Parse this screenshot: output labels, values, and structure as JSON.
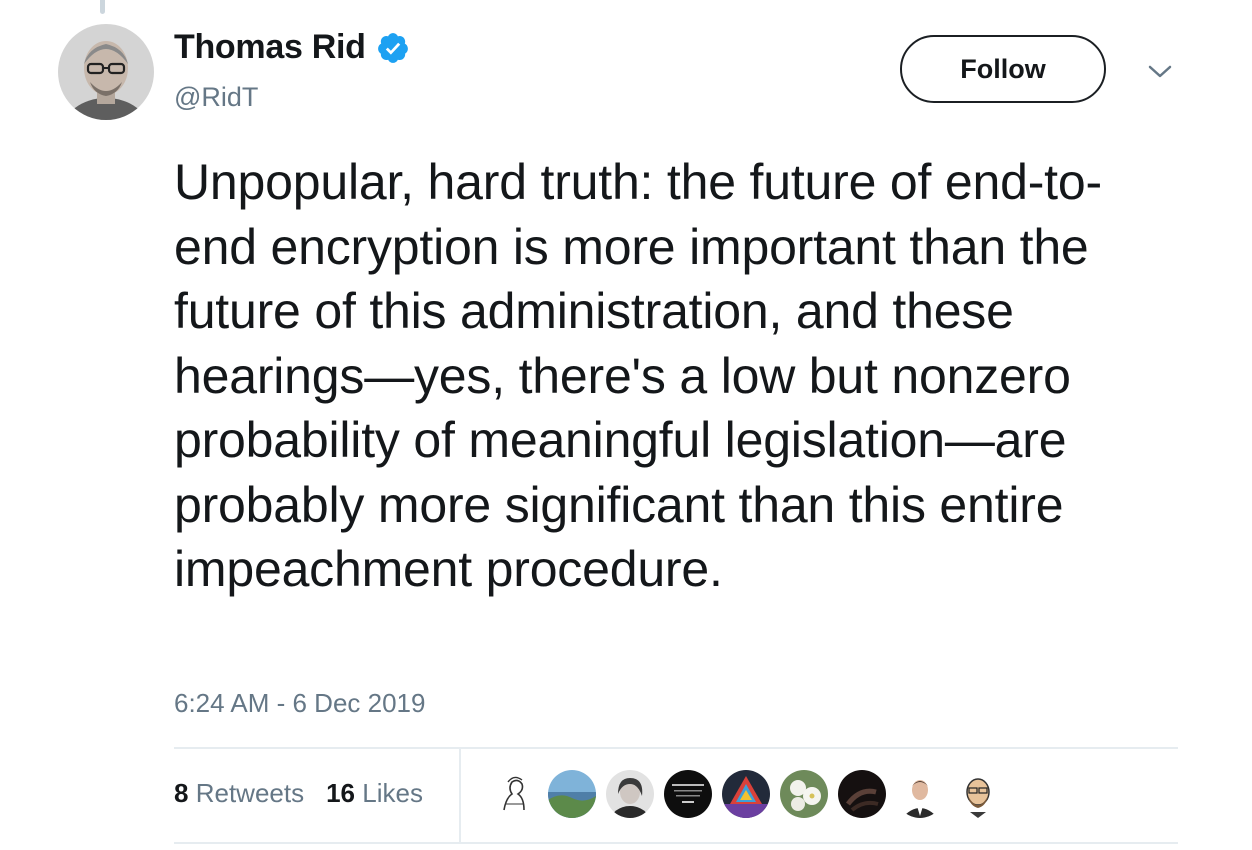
{
  "tweet": {
    "author": {
      "name": "Thomas Rid",
      "handle": "@RidT",
      "verified": true
    },
    "follow_label": "Follow",
    "text": "Unpopular, hard truth: the future of end-to-end encryption is more important than the future of this administration, and these hearings—yes, there's a low but nonzero probability of meaningful legislation—are probably more significant than this entire impeachment procedure.",
    "timestamp": "6:24 AM - 6 Dec 2019",
    "stats": {
      "retweets_count": "8",
      "retweets_label": "Retweets",
      "likes_count": "16",
      "likes_label": "Likes"
    }
  },
  "colors": {
    "text_primary": "#14171a",
    "text_secondary": "#657786",
    "verified_blue": "#1da1f2",
    "divider": "#e6ecf0"
  },
  "icons": {
    "verified": "verified-badge-icon",
    "caret": "chevron-down-icon"
  }
}
